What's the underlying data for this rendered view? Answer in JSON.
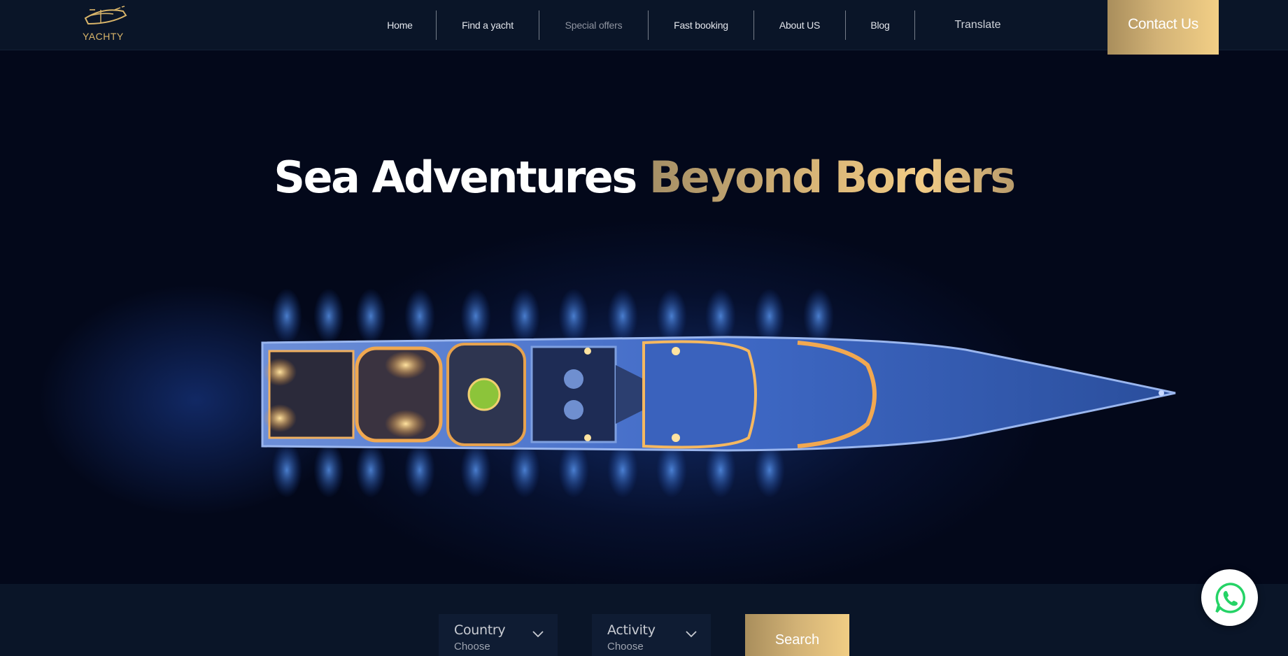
{
  "brand": {
    "name": "YACHTY",
    "accent_color": "#d9b56a",
    "icon": "yacht-logo-icon"
  },
  "nav": {
    "items": [
      {
        "label": "Home"
      },
      {
        "label": "Find a yacht"
      },
      {
        "label": "Special offers"
      },
      {
        "label": "Fast booking"
      },
      {
        "label": "About US"
      },
      {
        "label": "Blog"
      }
    ],
    "translate_label": "Translate",
    "contact_label": "Contact Us"
  },
  "hero": {
    "title_white": "Sea Adventures",
    "title_gold": "Beyond Borders",
    "background_image": "yacht-top-view-night"
  },
  "search": {
    "country": {
      "label": "Country",
      "value": "Choose",
      "icon": "chevron-down-icon"
    },
    "activity": {
      "label": "Activity",
      "value": "Choose",
      "icon": "chevron-down-icon"
    },
    "button_label": "Search"
  },
  "whatsapp": {
    "icon": "whatsapp-icon",
    "color": "#25d366"
  }
}
